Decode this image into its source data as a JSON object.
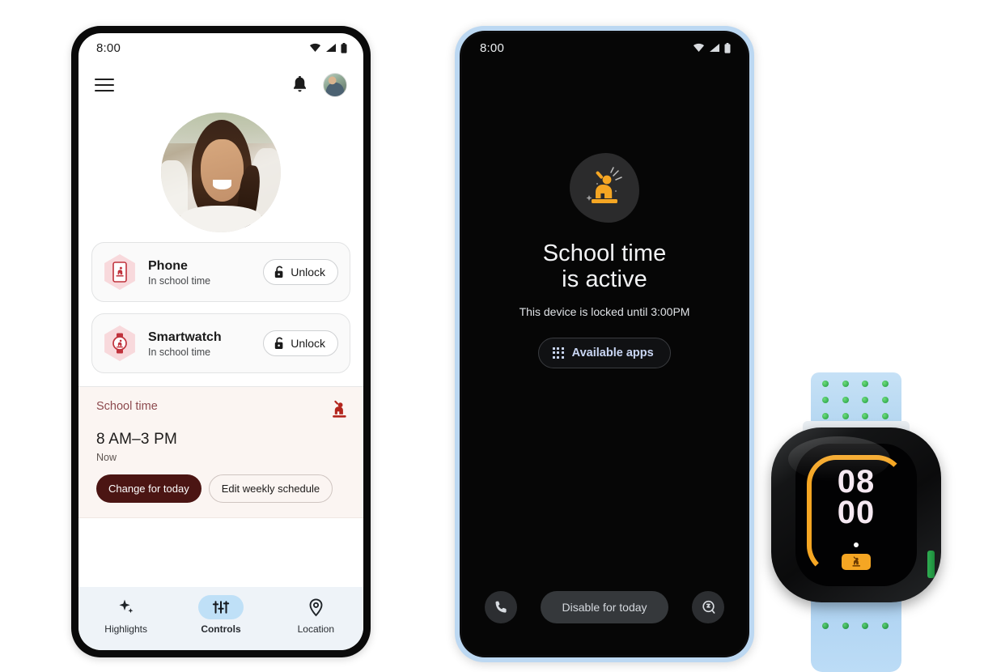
{
  "phone_light": {
    "status_bar": {
      "clock": "8:00",
      "icons": [
        "wifi-icon",
        "signal-icon",
        "battery-icon"
      ]
    },
    "app_bar": {
      "menu_icon": "hamburger-menu-icon",
      "notification_icon": "bell-icon",
      "account_avatar": "account-avatar"
    },
    "profile": {
      "photo_alt": "child-profile-photo"
    },
    "devices": [
      {
        "icon": "phone-device-icon",
        "name": "Phone",
        "status": "In school time",
        "action_label": "Unlock",
        "action_icon": "unlock-icon"
      },
      {
        "icon": "smartwatch-device-icon",
        "name": "Smartwatch",
        "status": "In school time",
        "action_label": "Unlock",
        "action_icon": "unlock-icon"
      }
    ],
    "school_time_card": {
      "label": "School time",
      "icon": "school-time-icon",
      "time_range": "8 AM–3 PM",
      "state": "Now",
      "primary_button": "Change for today",
      "secondary_button": "Edit weekly schedule",
      "accent_color": "#8d4a4e",
      "filled_button_color": "#4b1513",
      "background_color": "#fbf5f2"
    },
    "bottom_nav": {
      "items": [
        {
          "label": "Highlights",
          "icon": "sparkle-icon",
          "active": false
        },
        {
          "label": "Controls",
          "icon": "sliders-icon",
          "active": true
        },
        {
          "label": "Location",
          "icon": "location-pin-icon",
          "active": false
        }
      ],
      "active_pill_color": "#bfe0f7",
      "background_color": "#eef3f8"
    }
  },
  "phone_dark": {
    "status_bar": {
      "clock": "8:00",
      "icons": [
        "wifi-icon",
        "signal-icon",
        "battery-icon"
      ]
    },
    "lock_screen": {
      "illustration": "school-time-raised-hand-icon",
      "title_line1": "School time",
      "title_line2": "is active",
      "subtitle": "This device is locked until 3:00PM",
      "apps_button_label": "Available apps",
      "apps_button_icon": "grid-apps-icon",
      "accent_color": "#f5a623",
      "apps_text_color": "#c9d6f3"
    },
    "bottom_actions": {
      "left_icon": "phone-call-icon",
      "center_label": "Disable for today",
      "right_icon": "emergency-icon"
    },
    "frame_color": "#bcd8f2"
  },
  "smartwatch": {
    "face": {
      "hours": "08",
      "minutes": "00",
      "arc_color": "#f5a623",
      "time_color": "#f6e9f2",
      "chip_icon": "school-time-icon"
    },
    "band_color": "#b9d9f2",
    "side_button_color": "#2fae52"
  }
}
